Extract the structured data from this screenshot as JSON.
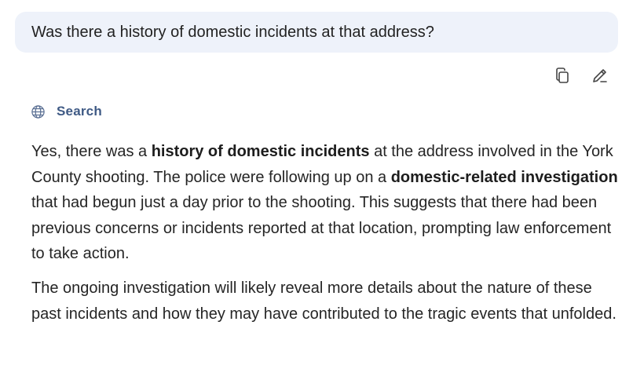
{
  "user_message": {
    "text": "Was there a history of domestic incidents at that address?"
  },
  "actions": [
    {
      "name": "copy-icon"
    },
    {
      "name": "edit-icon"
    }
  ],
  "source": {
    "icon": "globe-icon",
    "label": "Search"
  },
  "answer": {
    "p1": {
      "s1": "Yes, there was a ",
      "b1": "history of domestic incidents",
      "s2": " at the address involved in the York County shooting. The police were following up on a ",
      "b2": "domestic-related investigation",
      "s3": " that had begun just a day prior to the shooting. This suggests that there had been previous concerns or incidents reported at that location, prompting law enforcement to take action."
    },
    "p2": "The ongoing investigation will likely reveal more details about the nature of these past incidents and how they may have contributed to the tragic events that unfolded."
  },
  "colors": {
    "bubble_bg": "#eef2fa",
    "source_label": "#3f5a85",
    "text": "#252525"
  }
}
